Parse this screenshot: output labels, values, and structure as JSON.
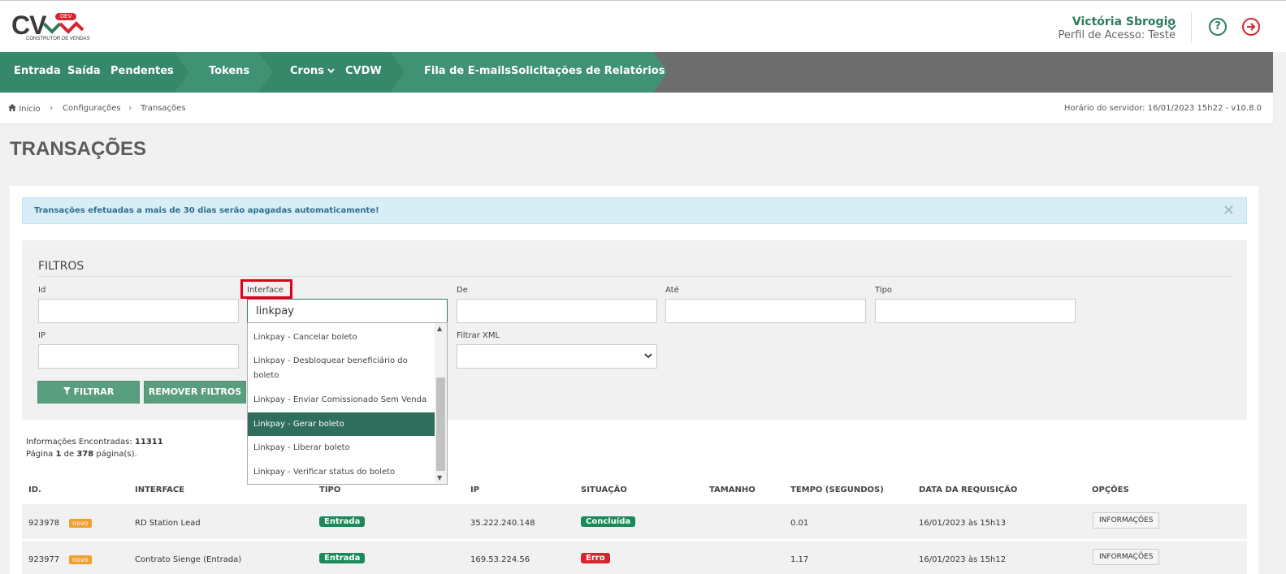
{
  "colors": {
    "brand_green": "#2f7a5c",
    "nav_green": "#35886a",
    "nav_gray": "#6d6d6d",
    "success": "#1a8a5a",
    "danger": "#d9232e",
    "new_badge": "#f0a030"
  },
  "header": {
    "logo_text": "CV",
    "logo_badge": "DEV",
    "logo_subtitle": "CONSTRUTOR DE VENDAS",
    "user_name": "Victória Sbrogio",
    "user_profile": "Perfil de Acesso: Teste",
    "help_icon_glyph": "?"
  },
  "nav": {
    "items": [
      {
        "label": "Entrada"
      },
      {
        "label": "Saída"
      },
      {
        "label": "Pendentes"
      },
      {
        "label": "Tokens"
      },
      {
        "label": "Crons"
      },
      {
        "label": "CVDW"
      },
      {
        "label": "Fila de E-mails"
      },
      {
        "label": "Solicitações de Relatórios"
      }
    ]
  },
  "breadcrumb": {
    "items": [
      "Início",
      "Configurações",
      "Transações"
    ],
    "server_time": "Horário do servidor: 16/01/2023 15h22 - v10.8.0"
  },
  "page": {
    "title": "TRANSAÇÕES",
    "alert": "Transações efetuadas a mais de 30 dias serão apagadas automaticamente!",
    "alert_close": "✕"
  },
  "filters": {
    "title": "FILTROS",
    "labels": {
      "id": "Id",
      "interface": "Interface",
      "de": "De",
      "ate": "Até",
      "tipo": "Tipo",
      "ip": "IP",
      "filtrar_xml": "Filtrar XML"
    },
    "values": {
      "id": "",
      "interface": "linkpay",
      "de": "",
      "ate": "",
      "tipo": "",
      "ip": "",
      "filtrar_xml": ""
    },
    "filter_button": "FILTRAR",
    "remove_button": "REMOVER FILTROS"
  },
  "dropdown": {
    "options": [
      "Linkpay - Cancelar boleto",
      "Linkpay - Desbloquear beneficiário do boleto",
      "Linkpay - Enviar Comissionado Sem Venda",
      "Linkpay - Gerar boleto",
      "Linkpay - Liberar boleto",
      "Linkpay - Verificar status do boleto"
    ],
    "highlighted": "Linkpay - Gerar boleto"
  },
  "results": {
    "found_label": "Informações Encontradas:",
    "found_count": "11311",
    "page_label_prefix": "Página",
    "page_current": "1",
    "page_of": "de",
    "page_total": "378",
    "page_suffix": "página(s)."
  },
  "table": {
    "headers": [
      "ID.",
      "INTERFACE",
      "TIPO",
      "IP",
      "SITUAÇÃO",
      "TAMANHO",
      "TEMPO (SEGUNDOS)",
      "DATA DA REQUISIÇÃO",
      "OPÇÕES"
    ],
    "rows": [
      {
        "id": "923978",
        "novo": "novo",
        "interface": "RD Station Lead",
        "tipo": "Entrada",
        "ip": "35.222.240.148",
        "situacao": "Concluída",
        "situacao_color": "#1a8a5a",
        "tamanho": "",
        "tempo": "0.01",
        "data": "16/01/2023 às 15h13",
        "opcao": "INFORMAÇÕES"
      },
      {
        "id": "923977",
        "novo": "novo",
        "interface": "Contrato Sienge (Entrada)",
        "tipo": "Entrada",
        "ip": "169.53.224.56",
        "situacao": "Erro",
        "situacao_color": "#d9232e",
        "tamanho": "",
        "tempo": "1.17",
        "data": "16/01/2023 às 15h12",
        "opcao": "INFORMAÇÕES"
      }
    ]
  }
}
